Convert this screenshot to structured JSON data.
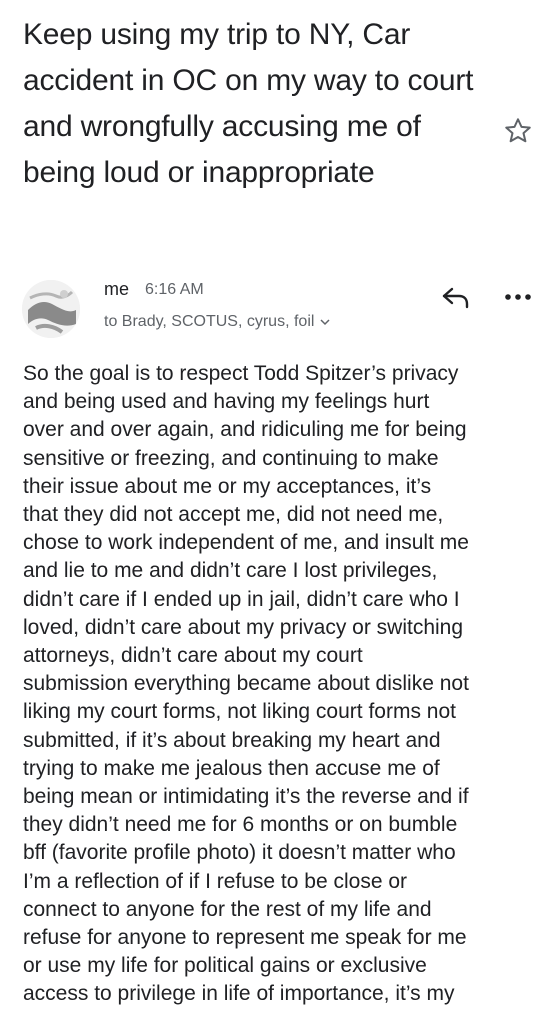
{
  "email": {
    "subject": "Keep using my trip to NY, Car accident in OC on my way to court and wrongfully accusing me of being loud or inappropriate",
    "sender": "me",
    "time": "6:16 AM",
    "recipients": "to Brady, SCOTUS, cyrus, foil",
    "body": "So the goal is to respect Todd Spitzer’s privacy\nand being used and having my feelings hurt\nover and over again, and ridiculing me for being\nsensitive or freezing, and continuing to make\ntheir issue about me or my acceptances, it’s\nthat they did not accept me, did not need me,\nchose to work independent of me, and insult me\nand lie to me and didn’t care I lost privileges,\ndidn’t care if I ended up in jail, didn’t care who I\nloved, didn’t care about my privacy or switching\nattorneys, didn’t care about my court\nsubmission everything became about dislike not\nliking my court forms, not liking court forms not\nsubmitted, if it’s about breaking my heart and\ntrying to make me jealous then accuse me of\nbeing mean or intimidating it’s the reverse and if\nthey didn’t need me for 6 months or on bumble\nbff (favorite profile photo) it doesn’t matter who\nI’m a reflection of if I refuse to be close or\nconnect to anyone for the rest of my life and\nrefuse for anyone to represent me speak for me\nor use my life for political gains or exclusive\naccess to privilege in life of importance, it’s my"
  },
  "icons": {
    "star": "star-outline-icon",
    "reply": "reply-arrow-icon",
    "more": "more-horizontal-icon",
    "expand": "chevron-down-icon"
  },
  "colors": {
    "text": "#202124",
    "secondary": "#5f6368",
    "background": "#ffffff"
  }
}
